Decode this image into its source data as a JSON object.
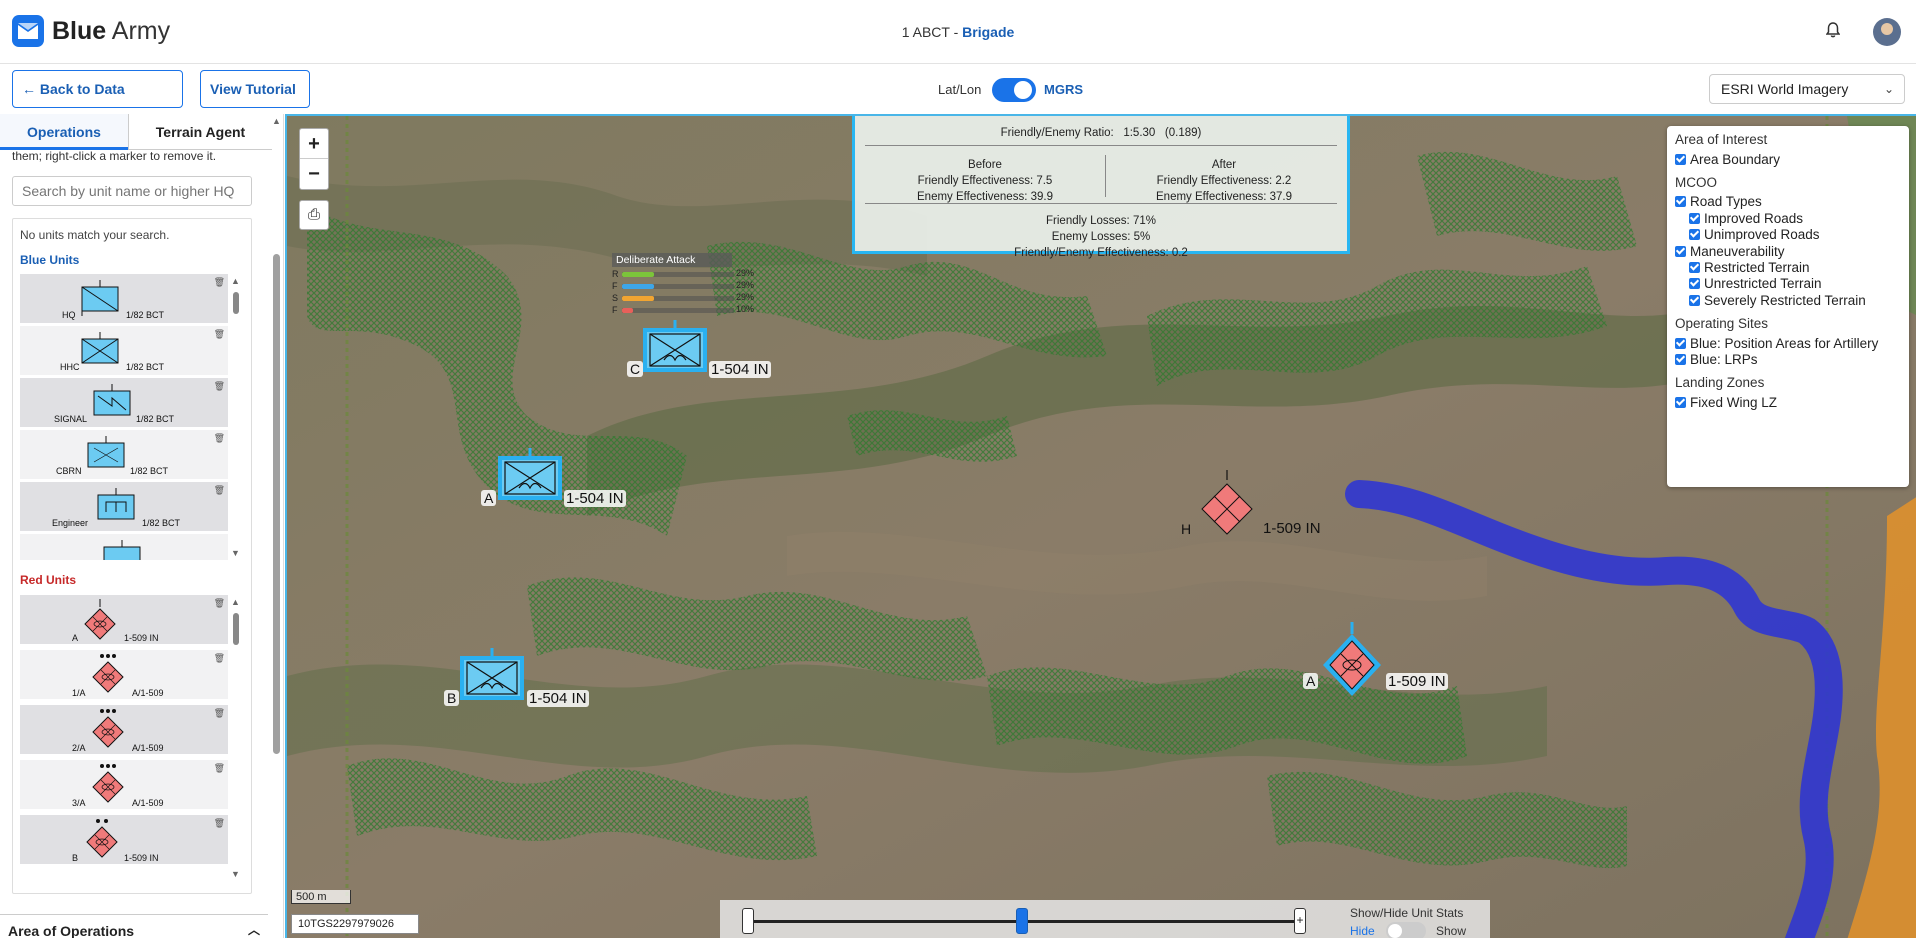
{
  "app": {
    "brand_bold": "Blue",
    "brand_light": "Army",
    "context_prefix": "1 ABCT - ",
    "context_highlight": "Brigade"
  },
  "toolbar": {
    "back_label": "← Back to Data Library",
    "tutorial_label": "View Tutorial",
    "coord_left": "Lat/Lon",
    "coord_right": "MGRS",
    "basemap": "ESRI World Imagery"
  },
  "sidebar": {
    "tabs": [
      "Operations",
      "Terrain Agent"
    ],
    "hint": "them; right-click a marker to remove it.",
    "search_placeholder": "Search by unit name or higher HQ",
    "no_match": "No units match your search.",
    "blue_title": "Blue Units",
    "red_title": "Red Units",
    "blue_units": [
      {
        "left": "HQ",
        "right": "1/82 BCT"
      },
      {
        "left": "HHC",
        "right": "1/82 BCT"
      },
      {
        "left": "SIGNAL",
        "right": "1/82 BCT"
      },
      {
        "left": "CBRN",
        "right": "1/82 BCT"
      },
      {
        "left": "Engineer",
        "right": "1/82 BCT"
      }
    ],
    "red_units": [
      {
        "left": "A",
        "right": "1-509 IN"
      },
      {
        "left": "1/A",
        "right": "A/1-509"
      },
      {
        "left": "2/A",
        "right": "A/1-509"
      },
      {
        "left": "3/A",
        "right": "A/1-509"
      },
      {
        "left": "B",
        "right": "1-509 IN"
      }
    ],
    "aoo_title": "Area of Operations"
  },
  "stats": {
    "ratio_label": "Friendly/Enemy Ratio:",
    "ratio_value": "1:5.30",
    "ratio_decimal": "(0.189)",
    "before_title": "Before",
    "before_friendly": "Friendly Effectiveness: 7.5",
    "before_enemy": "Enemy Effectiveness: 39.9",
    "after_title": "After",
    "after_friendly": "Friendly Effectiveness: 2.2",
    "after_enemy": "Enemy Effectiveness: 37.9",
    "friendly_losses": "Friendly Losses: 71%",
    "enemy_losses": "Enemy Losses: 5%",
    "fe_effectiveness": "Friendly/Enemy Effectiveness: 0.2"
  },
  "attack_card": {
    "title": "Deliberate Attack",
    "bars": [
      {
        "letter": "R",
        "pct": "29%",
        "fraction": 0.29,
        "color": "#7cc43a"
      },
      {
        "letter": "F",
        "pct": "29%",
        "fraction": 0.29,
        "color": "#3da6e8"
      },
      {
        "letter": "S",
        "pct": "29%",
        "fraction": 0.29,
        "color": "#f2a531"
      },
      {
        "letter": "F",
        "pct": "10%",
        "fraction": 0.1,
        "color": "#e8605a"
      }
    ]
  },
  "units_map": {
    "blue_c": {
      "echelon": "C",
      "name": "1-504 IN"
    },
    "blue_a": {
      "echelon": "A",
      "name": "1-504 IN"
    },
    "blue_b": {
      "echelon": "B",
      "name": "1-504 IN"
    },
    "red_h": {
      "echelon": "H",
      "name": "1-509 IN"
    },
    "red_a": {
      "echelon": "A",
      "name": "1-509 IN"
    }
  },
  "layers": {
    "sec_aoi": "Area of Interest",
    "area_boundary": "Area Boundary",
    "sec_mcoo": "MCOO",
    "road_types": "Road Types",
    "improved_roads": "Improved Roads",
    "unimproved_roads": "Unimproved Roads",
    "maneuverability": "Maneuverability",
    "restricted": "Restricted Terrain",
    "unrestricted": "Unrestricted Terrain",
    "severely_restricted": "Severely Restricted Terrain",
    "sec_sites": "Operating Sites",
    "pa_artillery": "Blue: Position Areas for Artillery",
    "lrps": "Blue: LRPs",
    "sec_lz": "Landing Zones",
    "fixed_wing": "Fixed Wing LZ"
  },
  "map_footer": {
    "scale": "500 m",
    "mgrs": "10TGS2297979026",
    "stats_toggle": "Show/Hide Unit Stats",
    "hide": "Hide",
    "show": "Show"
  }
}
